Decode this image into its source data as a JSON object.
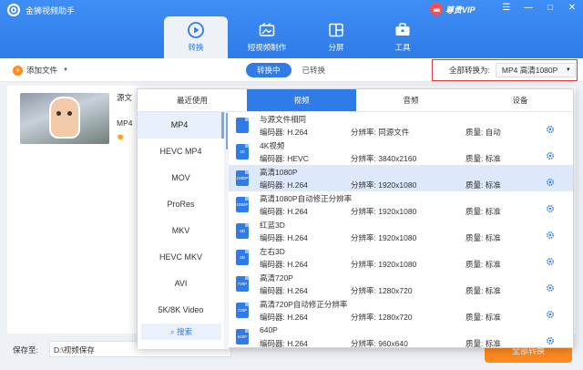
{
  "app": {
    "title": "金狮视频助手",
    "vip": "尊贵VIP"
  },
  "window_controls": [
    "☰",
    "—",
    "□",
    "✕"
  ],
  "nav": [
    {
      "label": "转换",
      "icon": "convert-icon",
      "active": true
    },
    {
      "label": "短视频制作",
      "icon": "film-icon",
      "active": false
    },
    {
      "label": "分屏",
      "icon": "split-screen-icon",
      "active": false
    },
    {
      "label": "工具",
      "icon": "toolbox-icon",
      "active": false
    }
  ],
  "toolbar": {
    "add_file": "添加文件",
    "tab_converting": "转换中",
    "tab_converted": "已转换",
    "convert_all_label": "全部转换为:",
    "convert_all_value": "MP4 高清1080P"
  },
  "file": {
    "name": "源文",
    "format": "MP4"
  },
  "bottom": {
    "save_to_label": "保存至:",
    "save_path": "D:\\视频保存",
    "start": "全部转换"
  },
  "popup": {
    "tabs": [
      "最近使用",
      "视频",
      "音频",
      "设备"
    ],
    "active_tab": 1,
    "formats": [
      "MP4",
      "HEVC MP4",
      "MOV",
      "ProRes",
      "MKV",
      "HEVC MKV",
      "AVI",
      "5K/8K Video"
    ],
    "active_format": 0,
    "search_label": "搜索",
    "options": [
      {
        "name": "与源文件相同",
        "encoder": "编码器:  H.264",
        "resolution": "分辨率:  同源文件",
        "quality": "质量:  自动",
        "icon_text": ""
      },
      {
        "name": "4K视频",
        "encoder": "编码器:  HEVC",
        "resolution": "分辨率:  3840x2160",
        "quality": "质量:  标准",
        "icon_text": "4K"
      },
      {
        "name": "高清1080P",
        "encoder": "编码器:  H.264",
        "resolution": "分辨率:  1920x1080",
        "quality": "质量:  标准",
        "icon_text": "1080P",
        "active": true
      },
      {
        "name": "高清1080P自动修正分辨率",
        "encoder": "编码器:  H.264",
        "resolution": "分辨率:  1920x1080",
        "quality": "质量:  标准",
        "icon_text": "1080P"
      },
      {
        "name": "红蓝3D",
        "encoder": "编码器:  H.264",
        "resolution": "分辨率:  1920x1080",
        "quality": "质量:  标准",
        "icon_text": "3D"
      },
      {
        "name": "左右3D",
        "encoder": "编码器:  H.264",
        "resolution": "分辨率:  1920x1080",
        "quality": "质量:  标准",
        "icon_text": "3D"
      },
      {
        "name": "高清720P",
        "encoder": "编码器:  H.264",
        "resolution": "分辨率:  1280x720",
        "quality": "质量:  标准",
        "icon_text": "720P"
      },
      {
        "name": "高清720P自动修正分辨率",
        "encoder": "编码器:  H.264",
        "resolution": "分辨率:  1280x720",
        "quality": "质量:  标准",
        "icon_text": "720P"
      },
      {
        "name": "640P",
        "encoder": "编码器:  H.264",
        "resolution": "分辨率:  960x640",
        "quality": "质量:  标准",
        "icon_text": "640P"
      }
    ]
  },
  "colors": {
    "primary": "#2f7be8",
    "accent": "#ff8a1f",
    "highlight": "#e23a3a"
  }
}
